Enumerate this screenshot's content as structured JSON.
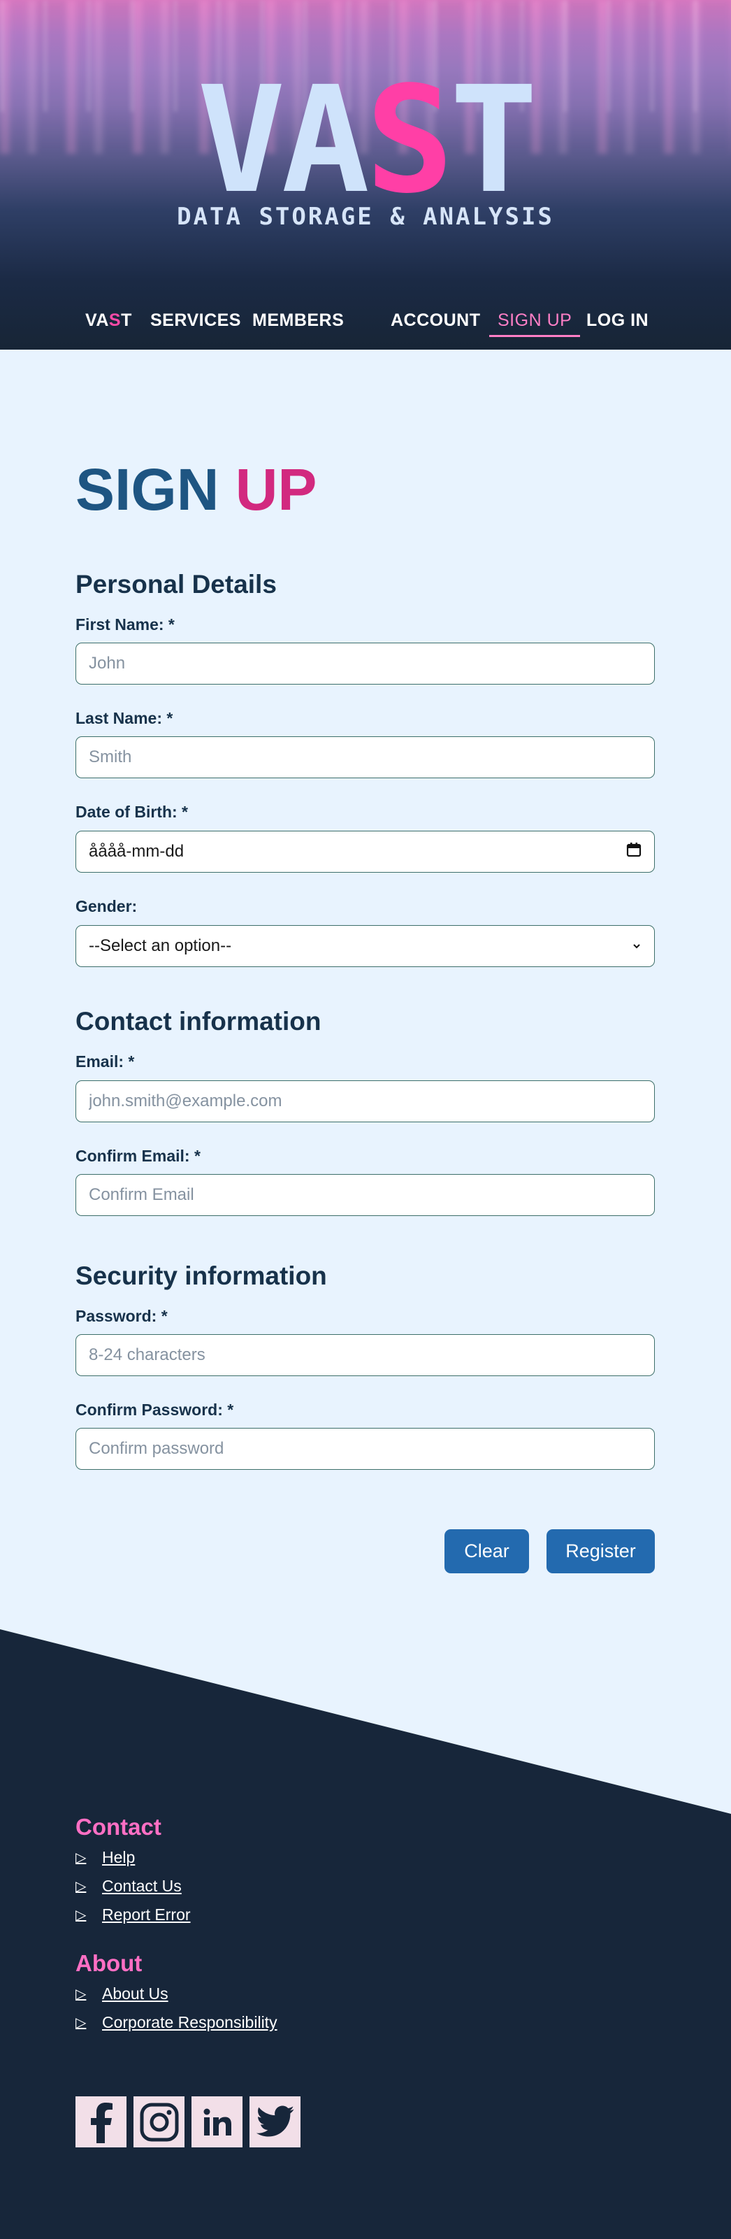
{
  "header": {
    "logo_part1": "VA",
    "logo_part2": "S",
    "logo_part3": "T",
    "tagline": "DATA STORAGE & ANALYSIS"
  },
  "nav": {
    "home_part1": "VA",
    "home_part2": "S",
    "home_part3": "T",
    "services": "SERVICES",
    "members": "MEMBERS",
    "account": "ACCOUNT",
    "signup": "SIGN UP",
    "login": "LOG IN"
  },
  "page": {
    "title_part1": "SIGN",
    "title_part2": "UP"
  },
  "form": {
    "personal": {
      "heading": "Personal Details",
      "first_name_label": "First Name: *",
      "first_name_placeholder": "John",
      "last_name_label": "Last Name: *",
      "last_name_placeholder": "Smith",
      "dob_label": "Date of Birth: *",
      "dob_value": "åååå-mm-dd",
      "gender_label": "Gender:",
      "gender_selected": "--Select an option--"
    },
    "contact": {
      "heading": "Contact information",
      "email_label": "Email: *",
      "email_placeholder": "john.smith@example.com",
      "confirm_email_label": "Confirm Email: *",
      "confirm_email_placeholder": "Confirm Email"
    },
    "security": {
      "heading": "Security information",
      "password_label": "Password: *",
      "password_placeholder": "8-24 characters",
      "confirm_password_label": "Confirm Password: *",
      "confirm_password_placeholder": "Confirm password"
    },
    "clear_label": "Clear",
    "register_label": "Register"
  },
  "footer": {
    "contact_heading": "Contact",
    "contact_links": [
      "Help",
      "Contact Us",
      "Report Error"
    ],
    "about_heading": "About",
    "about_links": [
      "About Us",
      "Corporate Responsibility"
    ],
    "social_icons": [
      "facebook-icon",
      "instagram-icon",
      "linkedin-icon",
      "twitter-icon"
    ]
  },
  "colors": {
    "accent_pink": "#ff3fa6",
    "title_blue": "#1e5582",
    "button_blue": "#236aaf",
    "footer_bg": "#17263a",
    "page_bg": "#e8f3fe"
  }
}
